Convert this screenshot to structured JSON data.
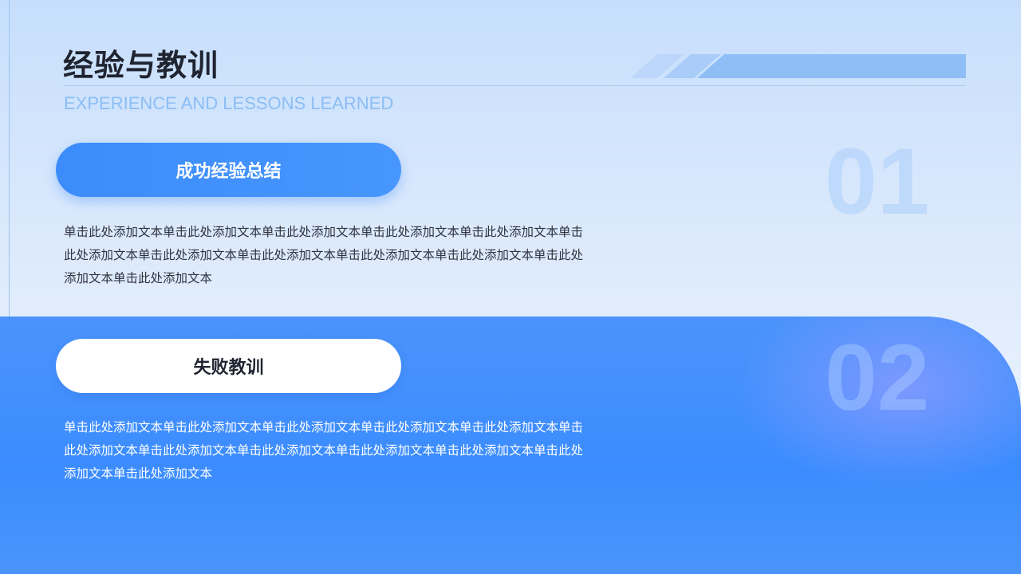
{
  "header": {
    "title": "经验与教训",
    "subtitle": "EXPERIENCE AND LESSONS LEARNED"
  },
  "sections": [
    {
      "number": "01",
      "heading": "成功经验总结",
      "body": "单击此处添加文本单击此处添加文本单击此处添加文本单击此处添加文本单击此处添加文本单击此处添加文本单击此处添加文本单击此处添加文本单击此处添加文本单击此处添加文本单击此处添加文本单击此处添加文本"
    },
    {
      "number": "02",
      "heading": "失败教训",
      "body": "单击此处添加文本单击此处添加文本单击此处添加文本单击此处添加文本单击此处添加文本单击此处添加文本单击此处添加文本单击此处添加文本单击此处添加文本单击此处添加文本单击此处添加文本单击此处添加文本"
    }
  ],
  "colors": {
    "accent": "#3c8cfb",
    "title_text": "#1f2430",
    "subtitle_text": "#8cbdf4",
    "stripe": "#8fbef7"
  }
}
